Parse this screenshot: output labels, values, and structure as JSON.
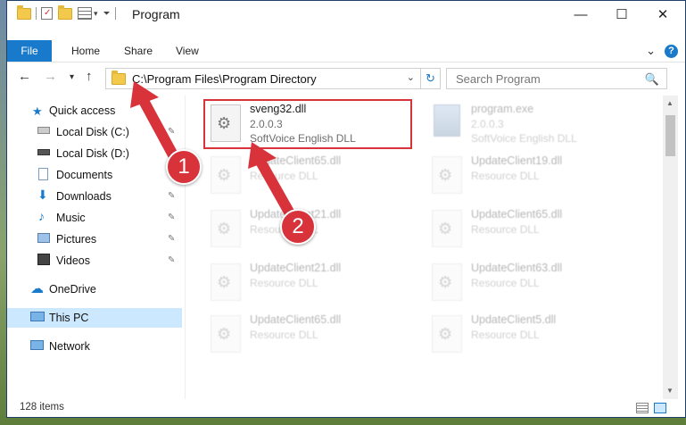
{
  "window": {
    "title": "Program",
    "controls": {
      "minimize": "—",
      "maximize": "☐",
      "close": "✕"
    }
  },
  "ribbon": {
    "file": "File",
    "tabs": [
      "Home",
      "Share",
      "View"
    ],
    "collapse": "⌄",
    "help": "?"
  },
  "nav": {
    "back": "←",
    "forward": "→",
    "recent": "▾",
    "up": "↑",
    "address": "C:\\Program Files\\Program Directory",
    "address_dropdown": "⌄",
    "refresh": "↻",
    "search_placeholder": "Search Program",
    "search_icon": "⚲"
  },
  "sidebar": {
    "items": [
      {
        "label": "Quick access",
        "icon": "star-icon",
        "pinned": false
      },
      {
        "label": "Local Disk (C:)",
        "icon": "drive-icon",
        "pinned": true
      },
      {
        "label": "Local Disk (D:)",
        "icon": "drive-icon",
        "pinned": false
      },
      {
        "label": "Documents",
        "icon": "documents-icon",
        "pinned": true
      },
      {
        "label": "Downloads",
        "icon": "download-icon",
        "pinned": true
      },
      {
        "label": "Music",
        "icon": "music-icon",
        "pinned": true
      },
      {
        "label": "Pictures",
        "icon": "pictures-icon",
        "pinned": true
      },
      {
        "label": "Videos",
        "icon": "videos-icon",
        "pinned": true
      },
      {
        "label": "OneDrive",
        "icon": "cloud-icon",
        "pinned": false
      },
      {
        "label": "This PC",
        "icon": "monitor-icon",
        "pinned": false,
        "selected": true
      },
      {
        "label": "Network",
        "icon": "network-icon",
        "pinned": false
      }
    ],
    "pin_glyph": "📌"
  },
  "files": [
    {
      "name": "sveng32.dll",
      "line2": "2.0.0.3",
      "line3": "SoftVoice English DLL",
      "highlighted": true
    },
    {
      "name": "program.exe",
      "line2": "2.0.0.3",
      "line3": "SoftVoice English DLL",
      "highlighted": false
    },
    {
      "name": "UpdateClient65.dll",
      "line2": "Resource DLL",
      "line3": ""
    },
    {
      "name": "UpdateClient19.dll",
      "line2": "Resource DLL",
      "line3": ""
    },
    {
      "name": "UpdateClient21.dll",
      "line2": "Resource DLL",
      "line3": ""
    },
    {
      "name": "UpdateClient65.dll",
      "line2": "Resource DLL",
      "line3": ""
    },
    {
      "name": "UpdateClient21.dll",
      "line2": "Resource DLL",
      "line3": ""
    },
    {
      "name": "UpdateClient63.dll",
      "line2": "Resource DLL",
      "line3": ""
    },
    {
      "name": "UpdateClient65.dll",
      "line2": "Resource DLL",
      "line3": ""
    },
    {
      "name": "UpdateClient5.dll",
      "line2": "Resource DLL",
      "line3": ""
    }
  ],
  "status": {
    "item_count": "128 items"
  },
  "callouts": [
    "1",
    "2"
  ],
  "colors": {
    "accent": "#1979ca",
    "highlight": "#d8323b",
    "selected_bg": "#cce8ff"
  }
}
